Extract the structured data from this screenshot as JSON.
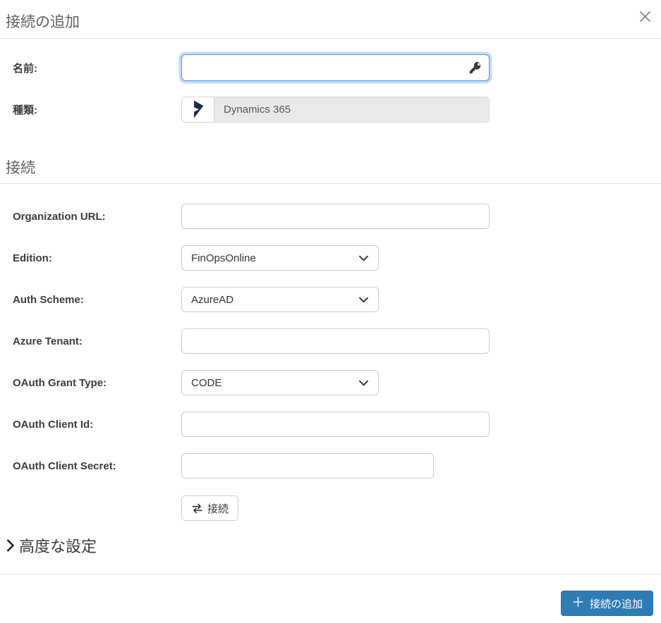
{
  "dialog": {
    "title": "接続の追加"
  },
  "top_fields": {
    "name": {
      "label": "名前:",
      "value": "",
      "icon": "key-icon"
    },
    "type": {
      "label": "種類:",
      "value": "Dynamics 365",
      "icon": "dynamics365-icon"
    }
  },
  "connection_section": {
    "title": "接続",
    "fields": [
      {
        "label": "Organization URL:",
        "type": "text",
        "value": ""
      },
      {
        "label": "Edition:",
        "type": "select",
        "value": "FinOpsOnline"
      },
      {
        "label": "Auth Scheme:",
        "type": "select",
        "value": "AzureAD"
      },
      {
        "label": "Azure Tenant:",
        "type": "text",
        "value": ""
      },
      {
        "label": "OAuth Grant Type:",
        "type": "select",
        "value": "CODE"
      },
      {
        "label": "OAuth Client Id:",
        "type": "text",
        "value": ""
      },
      {
        "label": "OAuth Client Secret:",
        "type": "text",
        "value": ""
      }
    ],
    "connect_button_label": "接続"
  },
  "advanced": {
    "label": "高度な設定"
  },
  "footer": {
    "add_button_plus": "＋",
    "add_button_label": "接続の追加"
  },
  "colors": {
    "accent_blue": "#2e7cb4",
    "focus_border": "#4f96dc",
    "focus_glow": "#c3dcf4",
    "field_border": "#cbcbcb",
    "disabled_field_bg": "#e9e9e9",
    "divider": "#e4e4e4",
    "title_text": "#5f5f5f",
    "label_text": "#3c3c3c",
    "dynamics_navy": "#1b2a4e"
  }
}
